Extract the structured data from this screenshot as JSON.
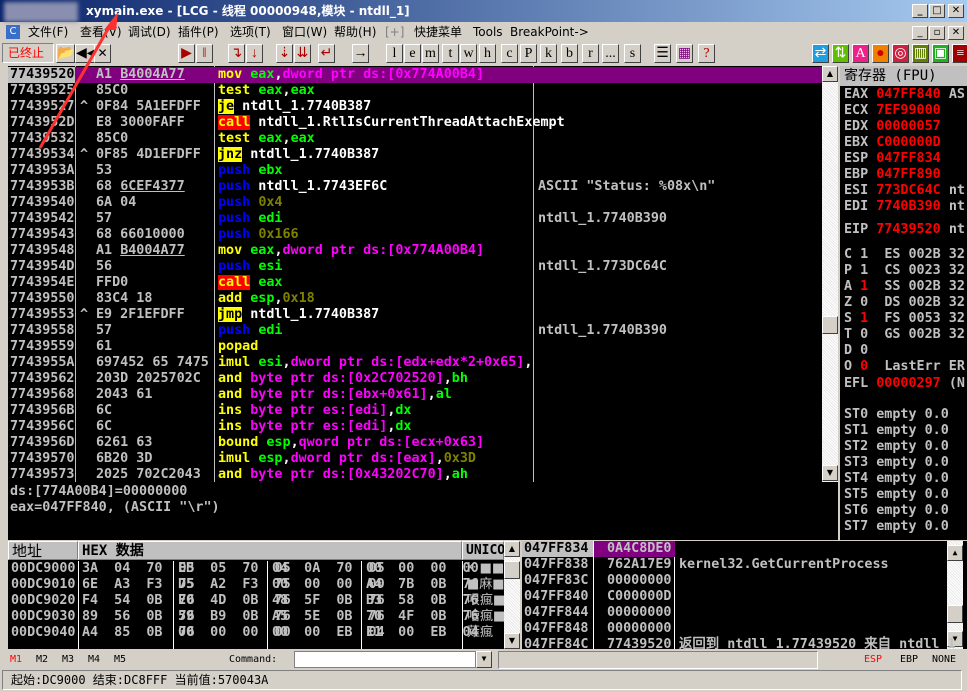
{
  "title": "xymain.exe - [LCG - 线程 00000948,模块 - ntdll_1]",
  "menu": [
    "文件(F)",
    "查看(V)",
    "调试(D)",
    "插件(P)",
    "选项(T)",
    "窗口(W)",
    "帮助(H)",
    "[+]",
    "快捷菜单",
    "Tools",
    "BreakPoint->"
  ],
  "status_state": "已终止",
  "toolbar_letters": [
    "l",
    "e",
    "m",
    "t",
    "w",
    "h",
    "c",
    "P",
    "k",
    "b",
    "r",
    "...",
    "s"
  ],
  "colors": {
    "selected": "#800080",
    "register_changed": "#ff0000",
    "jump_bg": "#ffff00",
    "call_bg": "#ff0000",
    "push": "#0000ff",
    "register": "#00ff00",
    "memory": "#ff00ff",
    "constant": "#808000"
  },
  "disasm": [
    {
      "addr": "77439520",
      "mark": "",
      "hex": "A1 ",
      "hexu": "B4004A77",
      "ops": [
        [
          "mov",
          "y"
        ],
        [
          " ",
          ""
        ],
        [
          "eax",
          "g"
        ],
        [
          ",",
          "w"
        ],
        [
          "dword ptr ds:[0x774A00B4]",
          "m"
        ]
      ],
      "cmt": ""
    },
    {
      "addr": "77439525",
      "mark": "",
      "hex": "85C0",
      "hexu": "",
      "ops": [
        [
          "test",
          "y"
        ],
        [
          " ",
          ""
        ],
        [
          "eax",
          "g"
        ],
        [
          ",",
          "w"
        ],
        [
          "eax",
          "g"
        ]
      ],
      "cmt": ""
    },
    {
      "addr": "77439527",
      "mark": "^",
      "hex": "0F84 5A1EFDFF",
      "hexu": "",
      "ops": [
        [
          "je",
          "j"
        ],
        [
          " ntdll_1.7740B387",
          "w"
        ]
      ],
      "cmt": ""
    },
    {
      "addr": "7743952D",
      "mark": "",
      "hex": "E8 3000FAFF",
      "hexu": "",
      "ops": [
        [
          "call",
          "c"
        ],
        [
          " ntdll_1.RtlIsCurrentThreadAttachExempt",
          "w"
        ]
      ],
      "cmt": ""
    },
    {
      "addr": "77439532",
      "mark": "",
      "hex": "85C0",
      "hexu": "",
      "ops": [
        [
          "test",
          "y"
        ],
        [
          " ",
          ""
        ],
        [
          "eax",
          "g"
        ],
        [
          ",",
          "w"
        ],
        [
          "eax",
          "g"
        ]
      ],
      "cmt": ""
    },
    {
      "addr": "77439534",
      "mark": "^",
      "hex": "0F85 4D1EFDFF",
      "hexu": "",
      "ops": [
        [
          "jnz",
          "j"
        ],
        [
          " ntdll_1.7740B387",
          "w"
        ]
      ],
      "cmt": ""
    },
    {
      "addr": "7743953A",
      "mark": "",
      "hex": "53",
      "hexu": "",
      "ops": [
        [
          "push",
          "b"
        ],
        [
          " ",
          ""
        ],
        [
          "ebx",
          "g"
        ]
      ],
      "cmt": ""
    },
    {
      "addr": "7743953B",
      "mark": "",
      "hex": "68 ",
      "hexu": "6CEF4377",
      "ops": [
        [
          "push",
          "b"
        ],
        [
          " ntdll_1.7743EF6C",
          "w"
        ]
      ],
      "cmt": "ASCII \"Status: %08x\\n\""
    },
    {
      "addr": "77439540",
      "mark": "",
      "hex": "6A 04",
      "hexu": "",
      "ops": [
        [
          "push",
          "b"
        ],
        [
          " ",
          ""
        ],
        [
          "0x4",
          "o"
        ]
      ],
      "cmt": ""
    },
    {
      "addr": "77439542",
      "mark": "",
      "hex": "57",
      "hexu": "",
      "ops": [
        [
          "push",
          "b"
        ],
        [
          " ",
          ""
        ],
        [
          "edi",
          "g"
        ]
      ],
      "cmt": "ntdll_1.7740B390"
    },
    {
      "addr": "77439543",
      "mark": "",
      "hex": "68 66010000",
      "hexu": "",
      "ops": [
        [
          "push",
          "b"
        ],
        [
          " ",
          ""
        ],
        [
          "0x166",
          "o"
        ]
      ],
      "cmt": ""
    },
    {
      "addr": "77439548",
      "mark": "",
      "hex": "A1 ",
      "hexu": "B4004A77",
      "ops": [
        [
          "mov",
          "y"
        ],
        [
          " ",
          ""
        ],
        [
          "eax",
          "g"
        ],
        [
          ",",
          "w"
        ],
        [
          "dword ptr ds:[0x774A00B4]",
          "m"
        ]
      ],
      "cmt": ""
    },
    {
      "addr": "7743954D",
      "mark": "",
      "hex": "56",
      "hexu": "",
      "ops": [
        [
          "push",
          "b"
        ],
        [
          " ",
          ""
        ],
        [
          "esi",
          "g"
        ]
      ],
      "cmt": "ntdll_1.773DC64C"
    },
    {
      "addr": "7743954E",
      "mark": "",
      "hex": "FFD0",
      "hexu": "",
      "ops": [
        [
          "call",
          "c"
        ],
        [
          " ",
          ""
        ],
        [
          "eax",
          "g"
        ]
      ],
      "cmt": ""
    },
    {
      "addr": "77439550",
      "mark": "",
      "hex": "83C4 18",
      "hexu": "",
      "ops": [
        [
          "add",
          "y"
        ],
        [
          " ",
          ""
        ],
        [
          "esp",
          "g"
        ],
        [
          ",",
          "w"
        ],
        [
          "0x18",
          "o"
        ]
      ],
      "cmt": ""
    },
    {
      "addr": "77439553",
      "mark": "^",
      "hex": "E9 2F1EFDFF",
      "hexu": "",
      "ops": [
        [
          "jmp",
          "j"
        ],
        [
          " ntdll_1.7740B387",
          "w"
        ]
      ],
      "cmt": ""
    },
    {
      "addr": "77439558",
      "mark": "",
      "hex": "57",
      "hexu": "",
      "ops": [
        [
          "push",
          "b"
        ],
        [
          " ",
          ""
        ],
        [
          "edi",
          "g"
        ]
      ],
      "cmt": "ntdll_1.7740B390"
    },
    {
      "addr": "77439559",
      "mark": "",
      "hex": "61",
      "hexu": "",
      "ops": [
        [
          "popad",
          "y"
        ]
      ],
      "cmt": ""
    },
    {
      "addr": "7743955A",
      "mark": "",
      "hex": "697452 65 7475",
      "hexu": "",
      "ops": [
        [
          "imul",
          "y"
        ],
        [
          " ",
          ""
        ],
        [
          "esi",
          "g"
        ],
        [
          ",",
          "w"
        ],
        [
          "dword ptr ds:[edx+edx*2+0x65]",
          "m"
        ],
        [
          ",",
          "w"
        ]
      ],
      "cmt": ""
    },
    {
      "addr": "77439562",
      "mark": "",
      "hex": "203D 2025702C",
      "hexu": "",
      "ops": [
        [
          "and",
          "y"
        ],
        [
          " ",
          ""
        ],
        [
          "byte ptr ds:[0x2C702520]",
          "m"
        ],
        [
          ",",
          "w"
        ],
        [
          "bh",
          "g"
        ]
      ],
      "cmt": ""
    },
    {
      "addr": "77439568",
      "mark": "",
      "hex": "2043 61",
      "hexu": "",
      "ops": [
        [
          "and",
          "y"
        ],
        [
          " ",
          ""
        ],
        [
          "byte ptr ds:[ebx+0x61]",
          "m"
        ],
        [
          ",",
          "w"
        ],
        [
          "al",
          "g"
        ]
      ],
      "cmt": ""
    },
    {
      "addr": "7743956B",
      "mark": "",
      "hex": "6C",
      "hexu": "",
      "ops": [
        [
          "ins",
          "y"
        ],
        [
          " ",
          ""
        ],
        [
          "byte ptr es:[edi]",
          "m"
        ],
        [
          ",",
          "w"
        ],
        [
          "dx",
          "g"
        ]
      ],
      "cmt": ""
    },
    {
      "addr": "7743956C",
      "mark": "",
      "hex": "6C",
      "hexu": "",
      "ops": [
        [
          "ins",
          "y"
        ],
        [
          " ",
          ""
        ],
        [
          "byte ptr es:[edi]",
          "m"
        ],
        [
          ",",
          "w"
        ],
        [
          "dx",
          "g"
        ]
      ],
      "cmt": ""
    },
    {
      "addr": "7743956D",
      "mark": "",
      "hex": "6261 63",
      "hexu": "",
      "ops": [
        [
          "bound",
          "y"
        ],
        [
          " ",
          ""
        ],
        [
          "esp",
          "g"
        ],
        [
          ",",
          "w"
        ],
        [
          "qword ptr ds:[ecx+0x63]",
          "m"
        ]
      ],
      "cmt": ""
    },
    {
      "addr": "77439570",
      "mark": "",
      "hex": "6B20 3D",
      "hexu": "",
      "ops": [
        [
          "imul",
          "y"
        ],
        [
          " ",
          ""
        ],
        [
          "esp",
          "g"
        ],
        [
          ",",
          "w"
        ],
        [
          "dword ptr ds:[eax]",
          "m"
        ],
        [
          ",",
          "w"
        ],
        [
          "0x3D",
          "o"
        ]
      ],
      "cmt": ""
    },
    {
      "addr": "77439573",
      "mark": "",
      "hex": "2025 702C2043",
      "hexu": "",
      "ops": [
        [
          "and",
          "y"
        ],
        [
          " ",
          ""
        ],
        [
          "byte ptr ds:[0x43202C70]",
          "m"
        ],
        [
          ",",
          "w"
        ],
        [
          "ah",
          "g"
        ]
      ],
      "cmt": ""
    }
  ],
  "info": [
    "ds:[774A00B4]=00000000",
    "eax=047FF840, (ASCII \"\\r\")"
  ],
  "registers": {
    "header": "寄存器 (FPU)",
    "gp": [
      [
        "EAX",
        "047FF840",
        "AS"
      ],
      [
        "ECX",
        "7EF99000",
        ""
      ],
      [
        "EDX",
        "00000057",
        ""
      ],
      [
        "EBX",
        "C000000D",
        ""
      ],
      [
        "ESP",
        "047FF834",
        ""
      ],
      [
        "EBP",
        "047FF890",
        ""
      ],
      [
        "ESI",
        "773DC64C",
        "nt"
      ],
      [
        "EDI",
        "7740B390",
        "nt"
      ]
    ],
    "eip": [
      "EIP",
      "77439520",
      "nt"
    ],
    "flags": [
      [
        "C",
        "1",
        false,
        "ES 002B 32"
      ],
      [
        "P",
        "1",
        false,
        "CS 0023 32"
      ],
      [
        "A",
        "1",
        true,
        "SS 002B 32"
      ],
      [
        "Z",
        "0",
        false,
        "DS 002B 32"
      ],
      [
        "S",
        "1",
        true,
        "FS 0053 32"
      ],
      [
        "T",
        "0",
        false,
        "GS 002B 32"
      ],
      [
        "D",
        "0",
        false,
        ""
      ],
      [
        "O",
        "0",
        true,
        "LastErr ER"
      ]
    ],
    "efl": [
      "EFL",
      "00000297",
      "(N"
    ],
    "st": [
      "ST0 empty 0.0",
      "ST1 empty 0.0",
      "ST2 empty 0.0",
      "ST3 empty 0.0",
      "ST4 empty 0.0",
      "ST5 empty 0.0",
      "ST6 empty 0.0",
      "ST7 empty 0.0"
    ]
  },
  "dump": {
    "headers": [
      "地址",
      "HEX 数据",
      "UNICO"
    ],
    "rows": [
      {
        "addr": "00DC9000",
        "bytes": [
          "3A 04 70 05",
          "EB 05 70 05",
          "04 0A 70 05",
          "00 00 00 00"
        ],
        "uni": "K ■■■"
      },
      {
        "addr": "00DC9010",
        "bytes": [
          "6E A3 F3 75",
          "D5 A2 F3 75",
          "00 00 00 00",
          "A4 7B 0B 76"
        ],
        "uni": "■麻■痢"
      },
      {
        "addr": "00DC9020",
        "bytes": [
          "F4 54 0B 76",
          "E0 4D 0B 76",
          "48 5F 0B 76",
          "B3 58 0B 76"
        ],
        "uni": "哏瘋■"
      },
      {
        "addr": "00DC9030",
        "bytes": [
          "89 56 0B 76",
          "59 B9 0B 76",
          "A5 5E 0B 76",
          "70 4F 0B 76"
        ],
        "uni": "噲瘋■"
      },
      {
        "addr": "00DC9040",
        "bytes": [
          "A4 85 0B 76",
          "00 00 00 00",
          "00 00 EB 04",
          "E1 00 EB 04"
        ],
        "uni": "薙瘋"
      }
    ]
  },
  "stack": [
    [
      "047FF834",
      "0A4C8DE0",
      ""
    ],
    [
      "047FF838",
      "762A17E9",
      "kernel32.GetCurrentProcess"
    ],
    [
      "047FF83C",
      "00000000",
      ""
    ],
    [
      "047FF840",
      "C000000D",
      ""
    ],
    [
      "047FF844",
      "00000000",
      ""
    ],
    [
      "047FF848",
      "00000000",
      ""
    ],
    [
      "047FF84C",
      "77439520",
      "返回到 ntdll_1.77439520 来自 ntdll_1"
    ]
  ],
  "bottom": {
    "mtabs": [
      "M1",
      "M2",
      "M3",
      "M4",
      "M5"
    ],
    "command_label": "Command:",
    "command_value": "",
    "stack_modes": [
      "ESP",
      "EBP",
      "NONE"
    ]
  },
  "statusbar": "起始:DC9000 结束:DC8FFF 当前值:570043A"
}
